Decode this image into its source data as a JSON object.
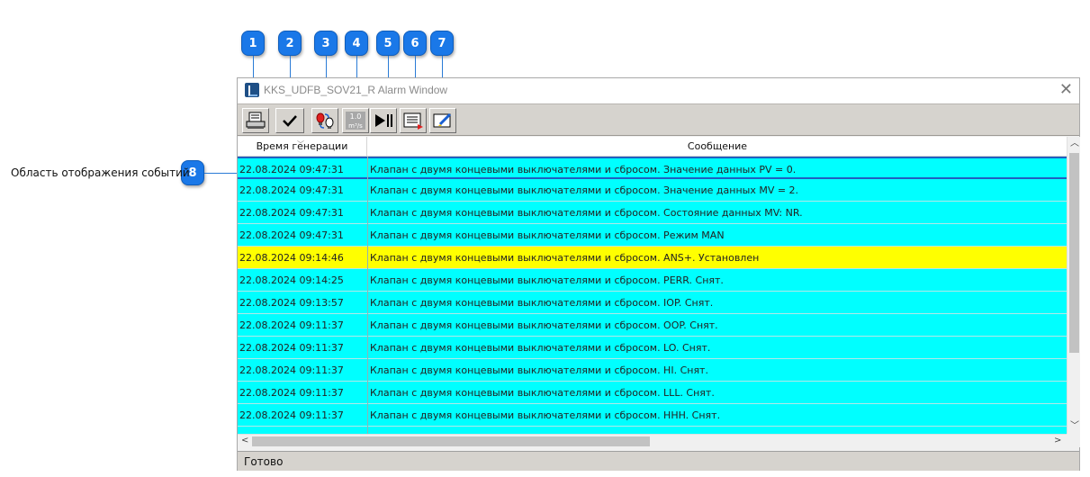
{
  "callouts": {
    "top_texts": [
      "",
      "",
      "",
      "",
      "",
      "",
      "",
      ""
    ],
    "badges": [
      "1",
      "2",
      "3",
      "4",
      "5",
      "6",
      "7",
      "8"
    ],
    "left_label": "Область отображения событий"
  },
  "window": {
    "title": "KKS_UDFB_SOV21_R Alarm Window",
    "close": "✕"
  },
  "toolbar": {
    "print_icon": "printer-icon",
    "ack_icon": "checkmark-icon",
    "filter_icon": "alarm-filter-icon",
    "units_icon": "units-icon",
    "units_top": "1.0",
    "units_bottom": "m³/s",
    "pause_icon": "play-pause-icon",
    "list_icon": "event-list-icon",
    "edit_icon": "edit-filter-icon"
  },
  "grid": {
    "columns": [
      "Время генерации",
      "Сообщение"
    ],
    "rows": [
      {
        "time": "22.08.2024 09:47:31",
        "message": "Клапан с двумя концевыми выключателями и сбросом. Значение данных PV = 0.",
        "bg": "#00ffff"
      },
      {
        "time": "22.08.2024 09:47:31",
        "message": "Клапан с двумя концевыми выключателями и сбросом. Значение данных MV = 2.",
        "bg": "#00ffff"
      },
      {
        "time": "22.08.2024 09:47:31",
        "message": "Клапан с двумя концевыми выключателями и сбросом. Состояние данных MV: NR.",
        "bg": "#00ffff"
      },
      {
        "time": "22.08.2024 09:47:31",
        "message": "Клапан с двумя концевыми выключателями и сбросом. Режим MAN",
        "bg": "#00ffff"
      },
      {
        "time": "22.08.2024 09:14:46",
        "message": "Клапан с двумя концевыми выключателями и сбросом. ANS+. Установлен",
        "bg": "#ffff00"
      },
      {
        "time": "22.08.2024 09:14:25",
        "message": "Клапан с двумя концевыми выключателями и сбросом. PERR. Снят.",
        "bg": "#00ffff"
      },
      {
        "time": "22.08.2024 09:13:57",
        "message": "Клапан с двумя концевыми выключателями и сбросом. IOP. Снят.",
        "bg": "#00ffff"
      },
      {
        "time": "22.08.2024 09:11:37",
        "message": "Клапан с двумя концевыми выключателями и сбросом. OOP. Снят.",
        "bg": "#00ffff"
      },
      {
        "time": "22.08.2024 09:11:37",
        "message": "Клапан с двумя концевыми выключателями и сбросом. LO. Снят.",
        "bg": "#00ffff"
      },
      {
        "time": "22.08.2024 09:11:37",
        "message": "Клапан с двумя концевыми выключателями и сбросом. HI. Снят.",
        "bg": "#00ffff"
      },
      {
        "time": "22.08.2024 09:11:37",
        "message": "Клапан с двумя концевыми выключателями и сбросом. LLL. Снят.",
        "bg": "#00ffff"
      },
      {
        "time": "22.08.2024 09:11:37",
        "message": "Клапан с двумя концевыми выключателями и сбросом. HHH. Снят.",
        "bg": "#00ffff"
      }
    ]
  },
  "status": {
    "text": "Готово"
  },
  "colors": {
    "accent": "#1a78e8",
    "row_normal": "#00ffff",
    "row_alert": "#ffff00",
    "selected_border": "#2060c0"
  }
}
